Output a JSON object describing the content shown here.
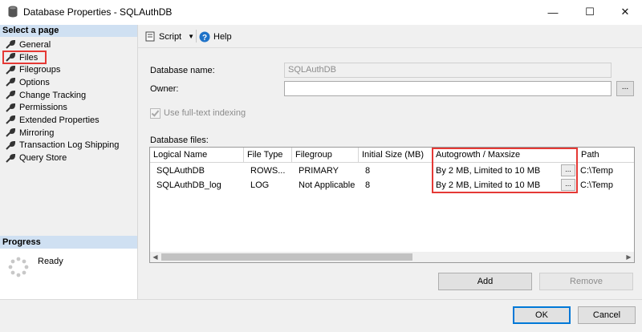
{
  "window": {
    "title": "Database Properties - SQLAuthDB",
    "minimize_glyph": "—",
    "maximize_glyph": "☐",
    "close_glyph": "✕",
    "app_icon": "database-icon"
  },
  "left_pane": {
    "header": "Select a page",
    "items": [
      {
        "label": "General",
        "icon": "wrench-icon"
      },
      {
        "label": "Files",
        "icon": "wrench-icon",
        "selected": true
      },
      {
        "label": "Filegroups",
        "icon": "wrench-icon"
      },
      {
        "label": "Options",
        "icon": "wrench-icon"
      },
      {
        "label": "Change Tracking",
        "icon": "wrench-icon"
      },
      {
        "label": "Permissions",
        "icon": "wrench-icon"
      },
      {
        "label": "Extended Properties",
        "icon": "wrench-icon"
      },
      {
        "label": "Mirroring",
        "icon": "wrench-icon"
      },
      {
        "label": "Transaction Log Shipping",
        "icon": "wrench-icon"
      },
      {
        "label": "Query Store",
        "icon": "wrench-icon"
      }
    ],
    "progress_header": "Progress",
    "progress_status": "Ready"
  },
  "toolbar": {
    "script_label": "Script",
    "help_label": "Help"
  },
  "form": {
    "database_name_label": "Database name:",
    "database_name_value": "SQLAuthDB",
    "owner_label": "Owner:",
    "owner_value": "",
    "owner_browse": "...",
    "fulltext_label": "Use full-text indexing",
    "fulltext_checked": true,
    "database_files_label": "Database files:"
  },
  "files_grid": {
    "columns": [
      "Logical Name",
      "File Type",
      "Filegroup",
      "Initial Size (MB)",
      "Autogrowth / Maxsize",
      "Path"
    ],
    "rows": [
      [
        "SQLAuthDB",
        "ROWS...",
        "PRIMARY",
        "8",
        "By 2 MB, Limited to 10 MB",
        "C:\\Temp"
      ],
      [
        "SQLAuthDB_log",
        "LOG",
        "Not Applicable",
        "8",
        "By 2 MB, Limited to 10 MB",
        "C:\\Temp"
      ]
    ],
    "cell_button": "...",
    "scroll_left": "◀",
    "scroll_right": "▶"
  },
  "actions": {
    "add_label": "Add",
    "remove_label": "Remove"
  },
  "footer": {
    "ok_label": "OK",
    "cancel_label": "Cancel"
  },
  "colors": {
    "highlight_red": "#e53935",
    "pane_header_blue": "#cfe0f2",
    "ok_border_blue": "#0078d7"
  }
}
